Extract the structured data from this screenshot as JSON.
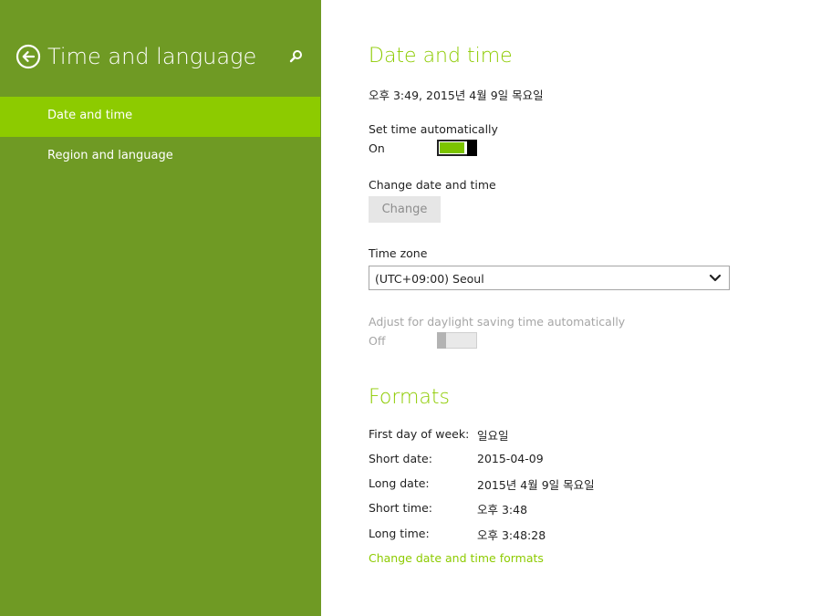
{
  "colors": {
    "sidebar_bg": "#6f9a24",
    "nav_active_bg": "#8dcb00",
    "accent": "#8dcb00",
    "toggle_on_fill": "#7cc400",
    "content_bg": "#ffffff"
  },
  "sidebar": {
    "back_icon": "back-arrow-circle-icon",
    "title": "Time and language",
    "search_icon": "search-icon",
    "items": [
      {
        "label": "Date and time",
        "active": true
      },
      {
        "label": "Region and language",
        "active": false
      }
    ]
  },
  "date_time": {
    "heading": "Date and time",
    "current_datetime": "오후 3:49, 2015년 4월 9일 목요일",
    "set_time_auto": {
      "label": "Set time automatically",
      "state_label": "On",
      "value": true
    },
    "change_date_time": {
      "label": "Change date and time",
      "button_label": "Change",
      "enabled": false
    },
    "time_zone": {
      "label": "Time zone",
      "selected": "(UTC+09:00) Seoul",
      "chevron_icon": "chevron-down-icon"
    },
    "daylight_saving": {
      "label": "Adjust for daylight saving time automatically",
      "state_label": "Off",
      "value": false,
      "enabled": false
    }
  },
  "formats": {
    "heading": "Formats",
    "rows": [
      {
        "label": "First day of week:",
        "value": "일요일"
      },
      {
        "label": "Short date:",
        "value": "2015-04-09"
      },
      {
        "label": "Long date:",
        "value": "2015년 4월 9일 목요일"
      },
      {
        "label": "Short time:",
        "value": "오후 3:48"
      },
      {
        "label": "Long time:",
        "value": "오후 3:48:28"
      }
    ],
    "change_link": "Change date and time formats"
  }
}
